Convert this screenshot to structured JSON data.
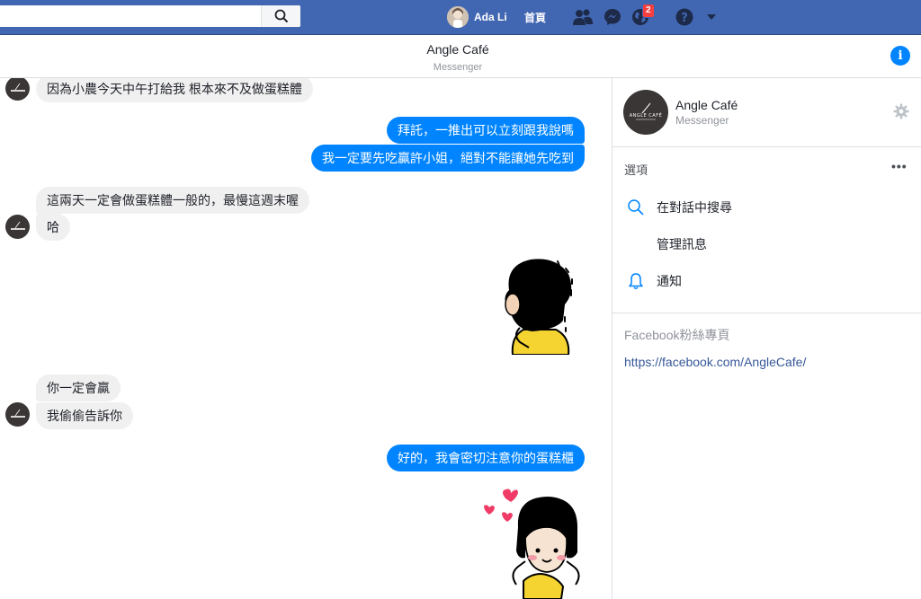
{
  "topbar": {
    "search_placeholder": "",
    "user_name": "Ada Li",
    "home_label": "首頁",
    "notification_count": "2"
  },
  "conversation": {
    "title": "Angle Café",
    "subtitle": "Messenger"
  },
  "messages": [
    {
      "side": "in",
      "text": "因為小農今天中午打給我 根本來不及做蛋糕體"
    },
    {
      "side": "out",
      "text": "拜託，一推出可以立刻跟我說嗎"
    },
    {
      "side": "out",
      "text": "我一定要先吃贏許小姐，絕對不能讓她先吃到"
    },
    {
      "side": "in",
      "text": "這兩天一定會做蛋糕體一般的，最慢這週末喔"
    },
    {
      "side": "in",
      "text": "哈"
    },
    {
      "side": "in",
      "text": "你一定會贏"
    },
    {
      "side": "in",
      "text": "我偷偷告訴你"
    },
    {
      "side": "out",
      "text": "好的，我會密切注意你的蛋糕櫃"
    }
  ],
  "stickers": [
    {
      "name": "sticker-girl-sad"
    },
    {
      "name": "sticker-girl-hearts"
    }
  ],
  "sidebar": {
    "name": "Angle Café",
    "subtitle": "Messenger",
    "options_label": "選項",
    "more_label": "•••",
    "options": [
      {
        "label": "在對話中搜尋",
        "icon": "search-icon"
      },
      {
        "label": "管理訊息",
        "icon": ""
      },
      {
        "label": "通知",
        "icon": "bell-icon"
      }
    ],
    "page_label": "Facebook粉絲專頁",
    "page_url": "https://facebook.com/AngleCafe/"
  },
  "colors": {
    "topbar": "#4267b2",
    "outgoing_bubble": "#0084ff",
    "incoming_bubble": "#f1f0f0",
    "link": "#365899",
    "badge": "#fa3e3e"
  }
}
